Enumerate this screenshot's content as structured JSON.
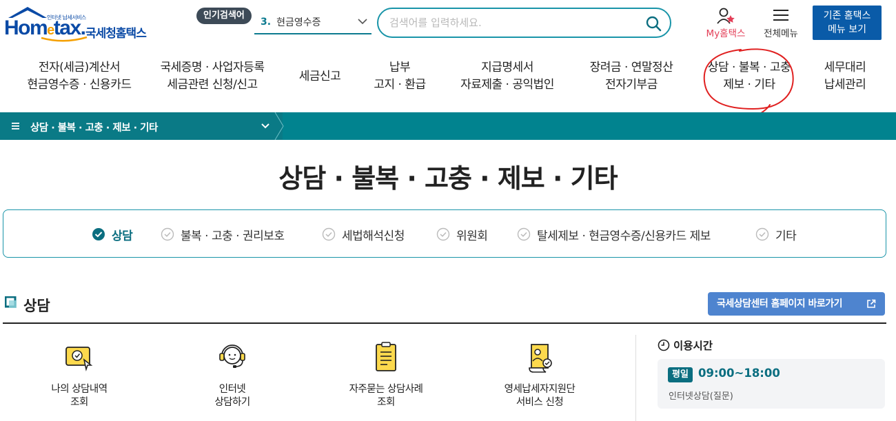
{
  "header": {
    "logo": {
      "small_text": "인터넷 납세서비스",
      "brand_main": "Hom",
      "brand_e": "e",
      "brand_tail": "tax.",
      "korean_name": "국세청홈택스"
    },
    "popular": {
      "badge": "인기검색어",
      "rank": "3.",
      "term": "현금영수증"
    },
    "search": {
      "placeholder": "검색어를 입력하세요."
    },
    "my_hometax": "My홈택스",
    "all_menu": "전체메뉴",
    "old_home": {
      "line1": "기존 홈택스",
      "line2": "메뉴 보기"
    }
  },
  "gnb": [
    {
      "line1": "전자(세금)계산서",
      "line2": "현금영수증 · 신용카드"
    },
    {
      "line1": "국세증명 · 사업자등록",
      "line2": "세금관련 신청/신고"
    },
    {
      "line1": "세금신고",
      "line2": ""
    },
    {
      "line1": "납부",
      "line2": "고지 · 환급"
    },
    {
      "line1": "지급명세서",
      "line2": "자료제출 · 공익법인"
    },
    {
      "line1": "장려금 · 연말정산",
      "line2": "전자기부금"
    },
    {
      "line1": "상담 · 불복 · 고충",
      "line2": "제보 · 기타"
    },
    {
      "line1": "세무대리",
      "line2": "납세관리"
    }
  ],
  "breadcrumb": {
    "current": "상담 · 불복 · 고충 · 제보 · 기타"
  },
  "page_title": "상담 · 불복 · 고충 · 제보 · 기타",
  "subtabs": [
    {
      "label": "상담",
      "active": true
    },
    {
      "label": "불복 · 고충 · 권리보호",
      "active": false
    },
    {
      "label": "세법해석신청",
      "active": false
    },
    {
      "label": "위원회",
      "active": false
    },
    {
      "label": "탈세제보 · 현금영수증/신용카드 제보",
      "active": false
    },
    {
      "label": "기타",
      "active": false
    }
  ],
  "section": {
    "title": "상담",
    "external_button": "국세상담센터 홈페이지 바로가기"
  },
  "services": [
    {
      "line1": "나의 상담내역",
      "line2": "조회",
      "icon": "consultation-history-icon"
    },
    {
      "line1": "인터넷",
      "line2": "상담하기",
      "icon": "headset-agent-icon"
    },
    {
      "line1": "자주묻는 상담사례",
      "line2": "조회",
      "icon": "faq-document-icon"
    },
    {
      "line1": "영세납세자지원단",
      "line2": "서비스 신청",
      "icon": "support-scroll-icon"
    }
  ],
  "hours": {
    "title": "이용시간",
    "badge": "평일",
    "time": "09:00~18:00",
    "note": "인터넷상담(질문)"
  },
  "colors": {
    "teal": "#01838f",
    "brand_blue": "#0a4aa6",
    "accent_orange": "#f5a000",
    "my_pink": "#e33e57",
    "button_blue": "#4e84cf"
  }
}
